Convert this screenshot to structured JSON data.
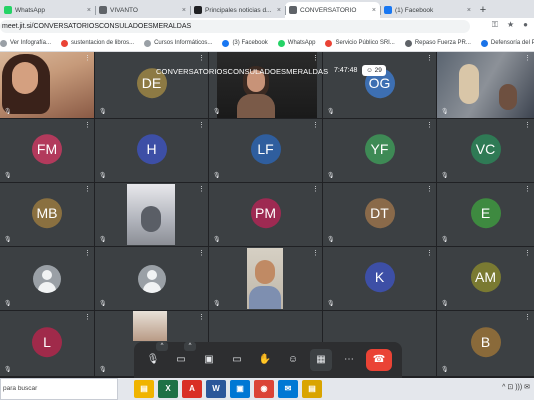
{
  "browser": {
    "tabs": [
      {
        "label": "WhatsApp",
        "favicon_color": "#25d366",
        "active": false
      },
      {
        "label": "VIVANTO",
        "favicon_color": "#5f6368",
        "active": false
      },
      {
        "label": "Principales noticias d...",
        "favicon_color": "#202124",
        "active": false
      },
      {
        "label": "CONVERSATORIO",
        "favicon_color": "#5f6368",
        "active": true
      },
      {
        "label": "(1) Facebook",
        "favicon_color": "#1877f2",
        "active": false
      }
    ],
    "tab_close": "×",
    "new_tab": "+",
    "url": "meet.jit.si/CONVERSATORIOSCONSULADOESMERALDAS",
    "bookmarks": [
      {
        "label": "Ver Infografía...",
        "color": "#9aa0a6"
      },
      {
        "label": "sustentacion de libros...",
        "color": "#ea4335"
      },
      {
        "label": "Cursos Informáticos...",
        "color": "#9aa0a6"
      },
      {
        "label": "(3) Facebook",
        "color": "#1877f2"
      },
      {
        "label": "WhatsApp",
        "color": "#25d366"
      },
      {
        "label": "Servicio Público SRI...",
        "color": "#ea4335"
      },
      {
        "label": "Repaso Fuerza PR...",
        "color": "#5f6368"
      },
      {
        "label": "Defensoría del Pue...",
        "color": "#1a73e8"
      }
    ]
  },
  "meeting": {
    "title": "CONVERSATORIOSCONSULADOESMERALDAS",
    "clock": "7:47:48",
    "participants_count": "29",
    "participants": [
      {
        "type": "video",
        "variant": "woman"
      },
      {
        "type": "initials",
        "initials": "DE",
        "color": "#8d7a44"
      },
      {
        "type": "video",
        "variant": "mid"
      },
      {
        "type": "initials",
        "initials": "OG",
        "color": "#3d6fb2"
      },
      {
        "type": "video",
        "variant": "right"
      },
      {
        "type": "initials",
        "initials": "FM",
        "color": "#b23a5c"
      },
      {
        "type": "initials",
        "initials": "H",
        "color": "#3d4fa6"
      },
      {
        "type": "initials",
        "initials": "LF",
        "color": "#2f5e9e"
      },
      {
        "type": "initials",
        "initials": "YF",
        "color": "#3e8a55"
      },
      {
        "type": "initials",
        "initials": "VC",
        "color": "#2f7a55"
      },
      {
        "type": "initials",
        "initials": "MB",
        "color": "#8a7040"
      },
      {
        "type": "video",
        "variant": "room"
      },
      {
        "type": "initials",
        "initials": "PM",
        "color": "#9e2a52"
      },
      {
        "type": "initials",
        "initials": "DT",
        "color": "#8a6a4a"
      },
      {
        "type": "initials",
        "initials": "E",
        "color": "#3e8a40"
      },
      {
        "type": "default"
      },
      {
        "type": "default"
      },
      {
        "type": "video",
        "variant": "man"
      },
      {
        "type": "initials",
        "initials": "K",
        "color": "#3d4fa6"
      },
      {
        "type": "initials",
        "initials": "AM",
        "color": "#7a7a32"
      },
      {
        "type": "initials",
        "initials": "L",
        "color": "#a02a4a"
      },
      {
        "type": "video",
        "variant": "partial"
      },
      {
        "type": "empty"
      },
      {
        "type": "empty"
      },
      {
        "type": "initials",
        "initials": "B",
        "color": "#8a6a3a"
      }
    ],
    "muted_glyph": "🎙",
    "tile_menu_glyph": "⋮"
  },
  "controls": [
    {
      "name": "mic-toggle-button",
      "icon": "mic-off-icon",
      "glyph": "🎙",
      "caret": true
    },
    {
      "name": "camera-toggle-button",
      "icon": "camera-off-icon",
      "glyph": "▭",
      "caret": true
    },
    {
      "name": "share-screen-button",
      "icon": "screen-share-icon",
      "glyph": "▣",
      "caret": false
    },
    {
      "name": "chat-button",
      "icon": "chat-icon",
      "glyph": "▭",
      "caret": false
    },
    {
      "name": "raise-hand-button",
      "icon": "hand-icon",
      "glyph": "✋",
      "caret": false
    },
    {
      "name": "participants-button",
      "icon": "participants-icon",
      "glyph": "☺",
      "caret": false
    },
    {
      "name": "tile-view-button",
      "icon": "tile-view-icon",
      "glyph": "▦",
      "caret": false,
      "selected": true
    },
    {
      "name": "more-button",
      "icon": "more-icon",
      "glyph": "⋯",
      "caret": false
    },
    {
      "name": "hangup-button",
      "icon": "hangup-icon",
      "glyph": "☎",
      "caret": false,
      "danger": true
    }
  ],
  "control_caret": "^",
  "taskbar": {
    "search_placeholder": "para buscar",
    "apps": [
      {
        "name": "explorer",
        "glyph": "▤",
        "color": "#f0b400"
      },
      {
        "name": "excel",
        "glyph": "X",
        "color": "#1e7145"
      },
      {
        "name": "pdf",
        "glyph": "A",
        "color": "#d93025"
      },
      {
        "name": "word",
        "glyph": "W",
        "color": "#2b579a"
      },
      {
        "name": "store",
        "glyph": "▣",
        "color": "#0078d4"
      },
      {
        "name": "chrome",
        "glyph": "◉",
        "color": "#db4437"
      },
      {
        "name": "mail",
        "glyph": "✉",
        "color": "#0078d4"
      },
      {
        "name": "explorer2",
        "glyph": "▤",
        "color": "#d9a400"
      }
    ],
    "tray": "^ ⊡ ))) ✉"
  }
}
